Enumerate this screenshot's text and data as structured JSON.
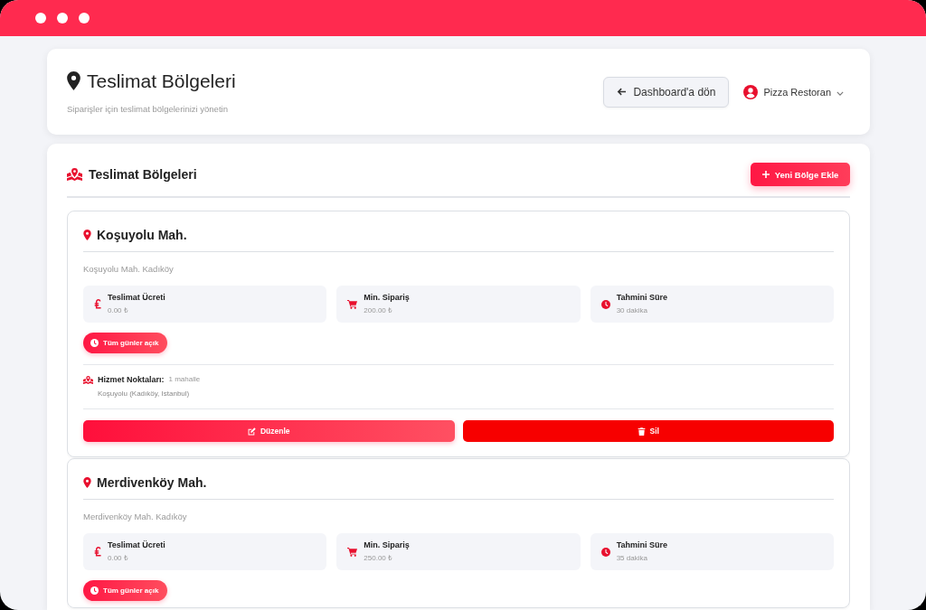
{
  "header": {
    "title": "Teslimat Bölgeleri",
    "subtitle": "Siparişler için teslimat bölgelerinizi yönetin",
    "back_button": "Dashboard'a dön",
    "user_menu": "Pizza Restoran"
  },
  "zones_panel": {
    "title": "Teslimat Bölgeleri",
    "add_button": "Yeni Bölge Ekle",
    "zones": [
      {
        "name": "Koşuyolu Mah.",
        "address": "Koşuyolu Mah. Kadıköy",
        "stats": [
          {
            "kind": "fee",
            "label": "Teslimat Ücreti",
            "value": "0.00 ₺"
          },
          {
            "kind": "min_order",
            "label": "Min. Sipariş",
            "value": "200.00 ₺"
          },
          {
            "kind": "duration",
            "label": "Tahmini Süre",
            "value": "30 dakika"
          }
        ],
        "hours_badge": "Tüm günler açık",
        "service_points": {
          "label": "Hizmet Noktaları:",
          "count": "1 mahalle",
          "items": [
            "Koşuyolu (Kadıköy, Istanbul)"
          ]
        },
        "actions": [
          {
            "kind": "edit",
            "label": "Düzenle"
          },
          {
            "kind": "delete",
            "label": "Sil"
          }
        ]
      },
      {
        "name": "Merdivenköy Mah.",
        "address": "Merdivenköy Mah. Kadıköy",
        "stats": [
          {
            "kind": "fee",
            "label": "Teslimat Ücreti",
            "value": "0.00 ₺"
          },
          {
            "kind": "min_order",
            "label": "Min. Sipariş",
            "value": "250.00 ₺"
          },
          {
            "kind": "duration",
            "label": "Tahmini Süre",
            "value": "35 dakika"
          }
        ],
        "hours_badge": "Tüm günler açık"
      }
    ]
  }
}
